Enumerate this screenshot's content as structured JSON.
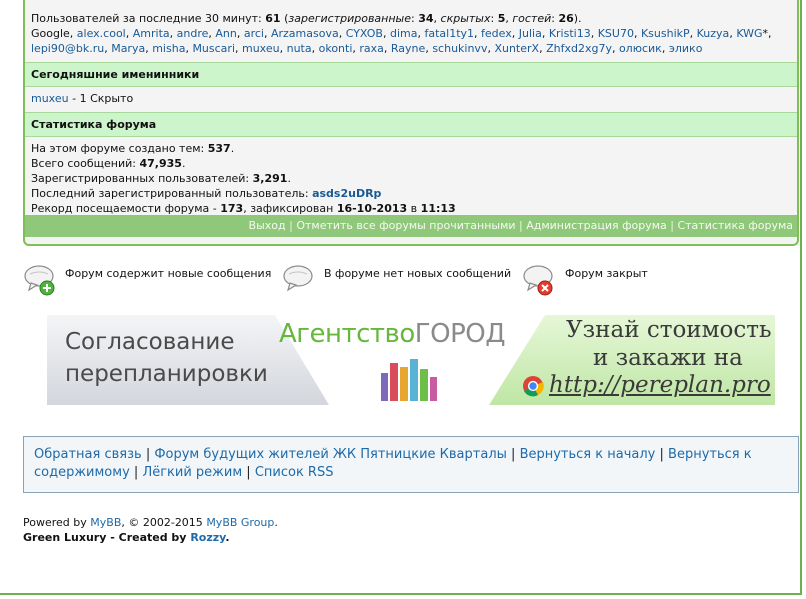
{
  "online": {
    "prefix": "Пользователей за последние 30 минут: ",
    "total": "61",
    "open_paren": " (",
    "registered_label": "зарегистрированные",
    "registered": "34",
    "hidden_label": "скрытых",
    "hidden": "5",
    "guests_label": "гостей",
    "guests": "26",
    "close_paren": ").",
    "bot": "Google",
    "users": [
      "alex.cool",
      "Amrita",
      "andre",
      "Ann",
      "arci",
      "Arzamasova",
      "CYXOB",
      "dima",
      "fatal1ty1",
      "fedex",
      "Julia",
      "Kristi13",
      "KSU70",
      "KsushikP",
      "Kuzya",
      "KWG",
      "lepi90@bk.ru",
      "Marya",
      "misha",
      "Muscari",
      "muxeu",
      "nuta",
      "okonti",
      "raxa",
      "Rayne",
      "schukinvv",
      "XunterX",
      "Zhfxd2xg7y",
      "олюсик",
      "элико"
    ],
    "kwg_suffix": "*"
  },
  "birthdays": {
    "title": "Сегодняшние именинники",
    "user": "muxeu",
    "rest": " - 1 Скрыто"
  },
  "forum_stats": {
    "title": "Статистика форума",
    "topics_label": "На этом форуме создано тем: ",
    "topics": "537",
    "posts_label": "Всего сообщений: ",
    "posts": "47,935",
    "members_label": "Зарегистрированных пользователей: ",
    "members": "3,291",
    "newest_label": "Последний зарегистрированный пользователь: ",
    "newest": "asds2uDRp",
    "record_label": "Рекорд посещаемости форума - ",
    "record": "173",
    "record_mid": ", зафиксирован ",
    "record_date": "16-10-2013",
    "record_in": " в ",
    "record_time": "11:13",
    "dot": "."
  },
  "footer_links": [
    "Выход",
    "Отметить все форумы прочитанными",
    "Администрация форума",
    "Статистика форума"
  ],
  "legend": {
    "new_posts": "Форум содержит новые сообщения",
    "no_new_posts": "В форуме нет новых сообщений",
    "closed": "Форум закрыт"
  },
  "banner": {
    "left_line1": "Согласование",
    "left_line2": "перепланировки",
    "brand_part1": "Агентство",
    "brand_part2": "ГОРОД",
    "right_line1": "Узнай стоимость",
    "right_line2": "и закажи на",
    "url": "http://pereplan.pro"
  },
  "nav": {
    "links": [
      "Обратная связь",
      "Форум будущих жителей ЖК Пятницкие Кварталы",
      "Вернуться к началу",
      "Вернуться к содержимому",
      "Лёгкий режим",
      "Список RSS"
    ]
  },
  "powered": {
    "prefix": "Powered by ",
    "mybb": "MyBB",
    "middle": ", © 2002-2015 ",
    "mybb_group": "MyBB Group",
    "end": ".",
    "theme": "Green Luxury - Created by ",
    "author": "Rozzy",
    "theme_end": "."
  },
  "colors": {
    "accent_green": "#7fbf55",
    "header_green": "#ccf5cc",
    "link_blue": "#1a5a96"
  }
}
